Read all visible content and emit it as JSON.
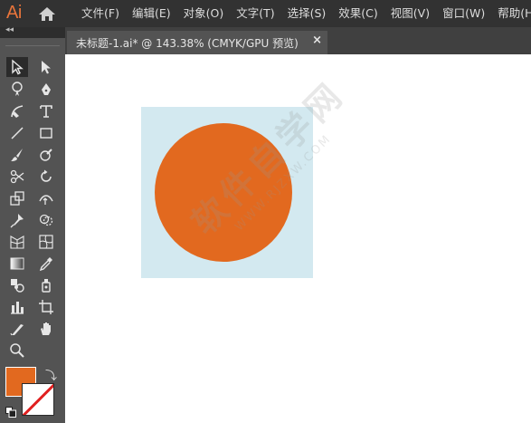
{
  "app": {
    "logo_text": "Ai",
    "home_icon": "home-icon"
  },
  "menu": [
    "文件(F)",
    "编辑(E)",
    "对象(O)",
    "文字(T)",
    "选择(S)",
    "效果(C)",
    "视图(V)",
    "窗口(W)",
    "帮助(H)"
  ],
  "toolpanel": {
    "collapse_glyph": "◂◂"
  },
  "tools": [
    {
      "name": "selection-tool",
      "active": true
    },
    {
      "name": "direct-selection-tool"
    },
    {
      "name": "magic-wand-tool"
    },
    {
      "name": "pen-tool"
    },
    {
      "name": "curvature-tool"
    },
    {
      "name": "type-tool",
      "glyph": "T"
    },
    {
      "name": "line-segment-tool"
    },
    {
      "name": "rectangle-tool"
    },
    {
      "name": "paintbrush-tool"
    },
    {
      "name": "shaper-tool"
    },
    {
      "name": "scissors-tool"
    },
    {
      "name": "rotate-tool"
    },
    {
      "name": "scale-tool"
    },
    {
      "name": "width-tool"
    },
    {
      "name": "puppet-warp-tool"
    },
    {
      "name": "shape-builder-tool"
    },
    {
      "name": "perspective-grid-tool"
    },
    {
      "name": "mesh-tool"
    },
    {
      "name": "gradient-tool"
    },
    {
      "name": "eyedropper-tool"
    },
    {
      "name": "blend-tool"
    },
    {
      "name": "symbol-sprayer-tool"
    },
    {
      "name": "column-graph-tool"
    },
    {
      "name": "artboard-tool"
    },
    {
      "name": "slice-tool"
    },
    {
      "name": "hand-tool"
    },
    {
      "name": "zoom-tool"
    }
  ],
  "colors": {
    "fill": "#e2691f",
    "stroke": "none"
  },
  "document_tab": {
    "title": "未标题-1.ai* @ 143.38% (CMYK/GPU 预览)",
    "close_glyph": "×"
  },
  "canvas": {
    "rect_color": "#d3e9f0",
    "circle_color": "#e2691f",
    "watermark_main": "软件自学网",
    "watermark_sub": "WWW.RJZXW.COM"
  }
}
